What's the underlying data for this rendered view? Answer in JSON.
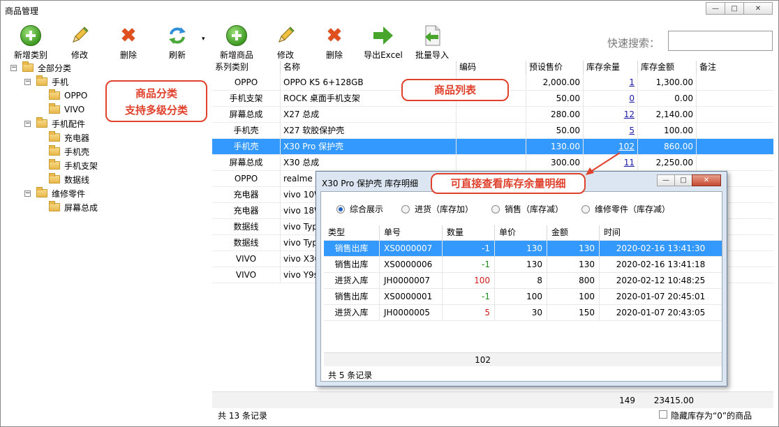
{
  "window": {
    "title": "商品管理"
  },
  "category_toolbar": [
    {
      "label": "新增类别",
      "icon": "add-icon"
    },
    {
      "label": "修改",
      "icon": "pencil-icon"
    },
    {
      "label": "删除",
      "icon": "delete-icon"
    },
    {
      "label": "刷新",
      "icon": "refresh-icon"
    }
  ],
  "product_toolbar": [
    {
      "label": "新增商品",
      "icon": "add-icon"
    },
    {
      "label": "修改",
      "icon": "pencil-icon"
    },
    {
      "label": "删除",
      "icon": "delete-icon"
    },
    {
      "label": "导出Excel",
      "icon": "export-arrow-icon"
    },
    {
      "label": "批量导入",
      "icon": "import-file-icon"
    }
  ],
  "search": {
    "label": "快速搜索：",
    "value": ""
  },
  "tree": {
    "root": "全部分类",
    "items": [
      "手机",
      "OPPO",
      "VIVO",
      "手机配件",
      "充电器",
      "手机壳",
      "手机支架",
      "数据线",
      "维修零件",
      "屏幕总成"
    ]
  },
  "annotations": {
    "category_note_line1": "商品分类",
    "category_note_line2": "支持多级分类",
    "list_note": "商品列表",
    "stock_note": "可直接查看库存余量明细"
  },
  "product_grid": {
    "headers": [
      "系列类别",
      "名称",
      "编码",
      "预设售价",
      "库存余量",
      "库存金额",
      "备注"
    ],
    "rows": [
      [
        "OPPO",
        "OPPO K5 6+128GB",
        "",
        "2,000.00",
        "1",
        "1,300.00",
        ""
      ],
      [
        "手机支架",
        "ROCK 桌面手机支架",
        "",
        "50.00",
        "0",
        "0.00",
        ""
      ],
      [
        "屏幕总成",
        "X27 总成",
        "",
        "280.00",
        "12",
        "2,140.00",
        ""
      ],
      [
        "手机壳",
        "X27 软胶保护壳",
        "",
        "50.00",
        "5",
        "100.00",
        ""
      ],
      [
        "手机壳",
        "X30 Pro 保护壳",
        "",
        "130.00",
        "102",
        "860.00",
        ""
      ],
      [
        "屏幕总成",
        "X30 总成",
        "",
        "300.00",
        "11",
        "2,250.00",
        ""
      ],
      [
        "OPPO",
        "realme",
        "",
        "",
        "",
        "",
        ""
      ],
      [
        "充电器",
        "vivo 10W",
        "",
        "",
        "",
        "",
        ""
      ],
      [
        "充电器",
        "vivo 18W",
        "",
        "",
        "",
        "",
        ""
      ],
      [
        "数据线",
        "vivo Typ",
        "",
        "",
        "",
        "",
        ""
      ],
      [
        "数据线",
        "vivo Typ",
        "",
        "",
        "",
        "",
        ""
      ],
      [
        "VIVO",
        "vivo X30",
        "",
        "",
        "",
        "",
        ""
      ],
      [
        "VIVO",
        "vivo Y9s",
        "",
        "",
        "",
        "",
        ""
      ]
    ],
    "selected_row": 4,
    "total_qty": "149",
    "total_amount": "23415.00",
    "record_count": "共 13 条记录",
    "hide_zero_label": "隐藏库存为“0”的商品"
  },
  "stock_dialog": {
    "title": "X30 Pro 保护壳 库存明细",
    "radio_options": [
      "综合展示",
      "进货（库存加）",
      "销售（库存减）",
      "维修零件（库存减）"
    ],
    "selected_option": 0,
    "headers": [
      "类型",
      "单号",
      "数量",
      "单价",
      "金额",
      "时间"
    ],
    "rows": [
      [
        "销售出库",
        "XS0000007",
        "-1",
        "130",
        "130",
        "2020-02-16 13:41:30"
      ],
      [
        "销售出库",
        "XS0000006",
        "-1",
        "130",
        "130",
        "2020-02-16 13:41:18"
      ],
      [
        "进货入库",
        "JH0000007",
        "100",
        "8",
        "800",
        "2020-02-12 10:48:25"
      ],
      [
        "销售出库",
        "XS0000001",
        "-1",
        "100",
        "100",
        "2020-01-07 20:45:01"
      ],
      [
        "进货入库",
        "JH0000005",
        "5",
        "30",
        "150",
        "2020-01-07 20:43:05"
      ]
    ],
    "selected_row": 0,
    "total_qty": "102",
    "record_count": "共 5 条记录"
  }
}
